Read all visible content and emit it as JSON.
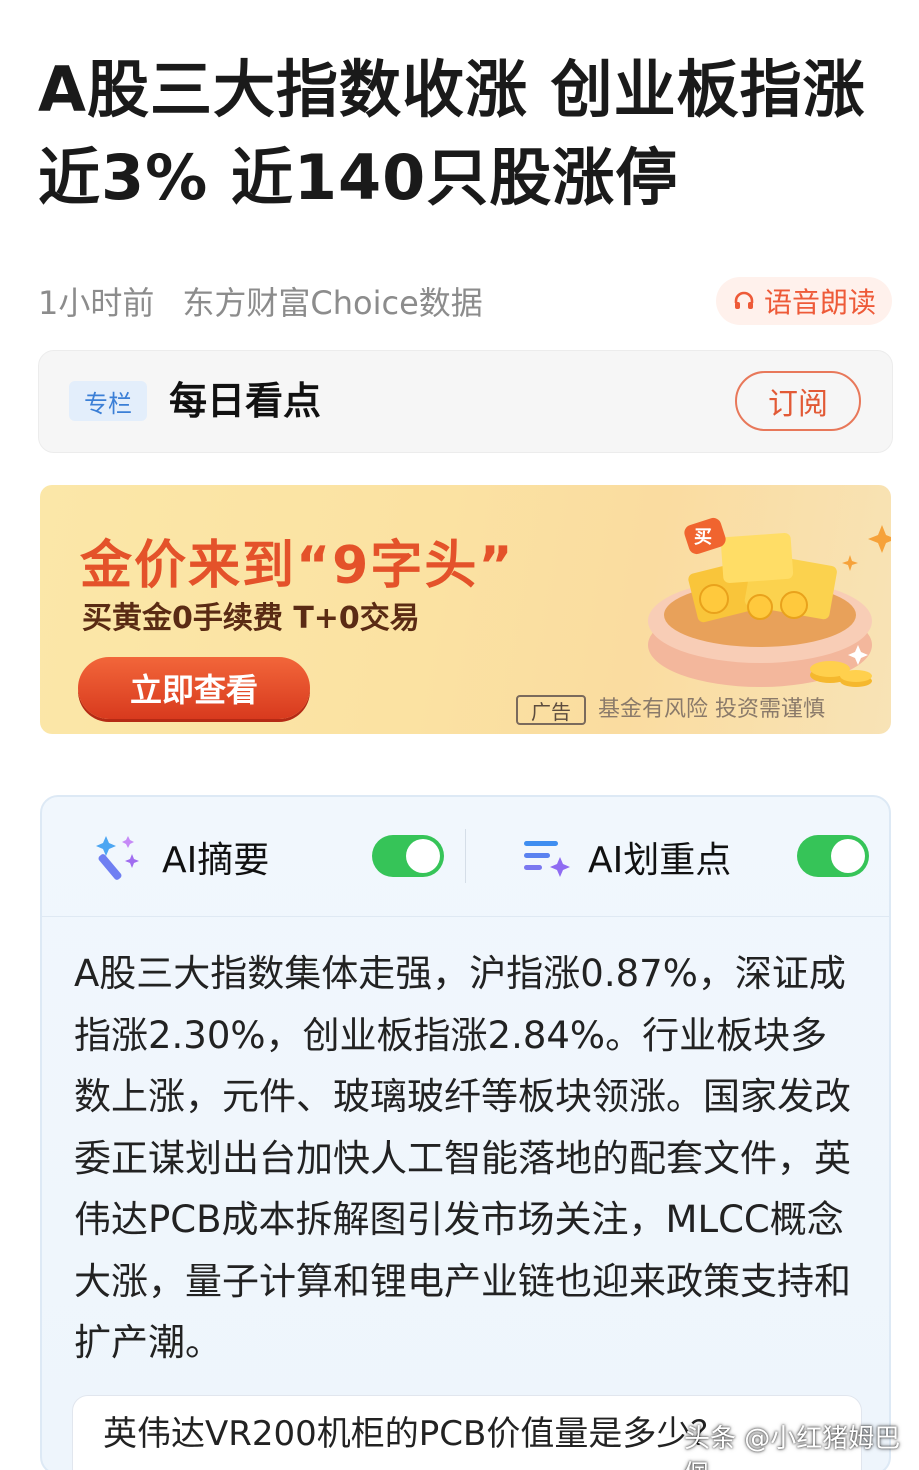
{
  "article": {
    "title": "A股三大指数收涨 创业板指涨近3% 近140只股涨停",
    "time": "1小时前",
    "source": "东方财富Choice数据"
  },
  "voice": {
    "label": "语音朗读",
    "icon": "headphones-icon"
  },
  "column": {
    "tag": "专栏",
    "name": "每日看点",
    "subscribe_label": "订阅"
  },
  "ad": {
    "headline": "金价来到“9字头”",
    "subline": "买黄金0手续费 T+0交易",
    "cta": "立即查看",
    "label": "广告",
    "disclaimer": "基金有风险 投资需谨慎",
    "badge_text": "买"
  },
  "ai": {
    "summary_label": "AI摘要",
    "summary_on": true,
    "highlight_label": "AI划重点",
    "highlight_on": true,
    "summary_text": "A股三大指数集体走强，沪指涨0.87%，深证成指涨2.30%，创业板指涨2.84%。行业板块多数上涨，元件、玻璃玻纤等板块领涨。国家发改委正谋划出台加快人工智能落地的配套文件，英伟达PCB成本拆解图引发市场关注，MLCC概念大涨，量子计算和锂电产业链也迎来政策支持和扩产潮。",
    "question": "英伟达VR200机柜的PCB价值量是多少？"
  },
  "watermark": "头条 @小红猪姆巴佩",
  "colors": {
    "accent": "#ee5a38",
    "toggle_on": "#36c458",
    "tag_blue": "#3b7fd6"
  }
}
